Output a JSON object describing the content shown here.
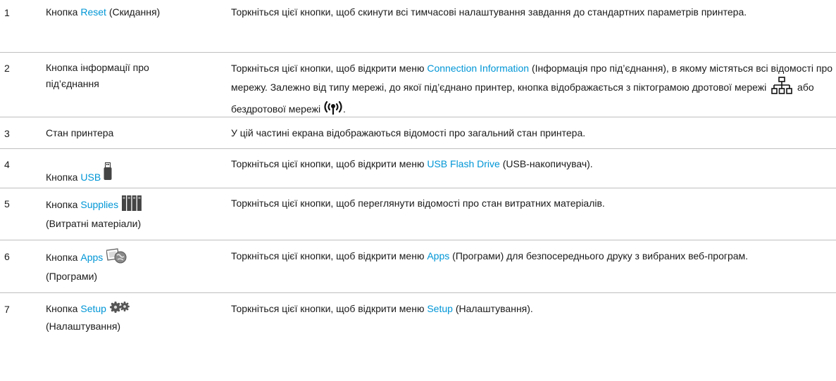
{
  "rows": [
    {
      "num": "1",
      "name_pre": "Кнопка ",
      "name_link": "Reset",
      "name_post": " (Скидання)",
      "desc": "Торкніться цієї кнопки, щоб скинути всі тимчасові налаштування завдання до стандартних параметрів принтера."
    },
    {
      "num": "2",
      "name": "Кнопка інформації про під’єднання",
      "desc_pre": "Торкніться цієї кнопки, щоб відкрити меню ",
      "desc_link": "Connection Information",
      "desc_post": " (Інформація про під’єднання), в якому містяться всі відомості про мережу. Залежно від типу мережі, до якої під’єднано принтер, кнопка відображається з піктограмою дротової мережі ",
      "desc_mid": " або бездротової мережі ",
      "desc_end": "."
    },
    {
      "num": "3",
      "name": "Стан принтера",
      "desc": "У цій частині екрана відображаються відомості про загальний стан принтера."
    },
    {
      "num": "4",
      "name_pre": "Кнопка ",
      "name_link": "USB",
      "desc_pre": "Торкніться цієї кнопки, щоб відкрити меню ",
      "desc_link": "USB Flash Drive",
      "desc_post": " (USB-накопичувач)."
    },
    {
      "num": "5",
      "name_pre": "Кнопка ",
      "name_link": "Supplies",
      "name_post": "(Витратні матеріали)",
      "desc": "Торкніться цієї кнопки, щоб переглянути відомості про стан витратних матеріалів."
    },
    {
      "num": "6",
      "name_pre": "Кнопка ",
      "name_link": "Apps",
      "name_post": "(Програми)",
      "desc_pre": "Торкніться цієї кнопки, щоб відкрити меню ",
      "desc_link": "Apps",
      "desc_post": " (Програми) для безпосереднього друку з вибраних веб-програм."
    },
    {
      "num": "7",
      "name_pre": "Кнопка ",
      "name_link": "Setup",
      "name_post": "(Налаштування)",
      "desc_pre": "Торкніться цієї кнопки, щоб відкрити меню ",
      "desc_link": "Setup",
      "desc_post": " (Налаштування)."
    }
  ],
  "icons": {
    "wired": "wired-network-icon",
    "wireless": "wireless-network-icon",
    "usb": "usb-flash-drive-icon",
    "supplies": "toner-cartridges-icon",
    "apps": "apps-icon",
    "setup": "gears-icon"
  },
  "colors": {
    "link": "#0096d6",
    "text": "#1a1a1a",
    "divider": "#bfbfbf"
  }
}
